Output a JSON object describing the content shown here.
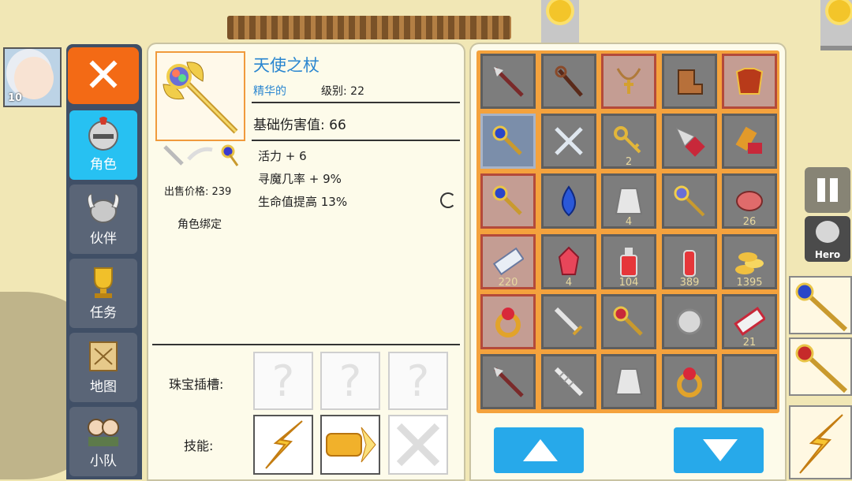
{
  "colors": {
    "accent": "#27c1f2",
    "close": "#f36a15",
    "item_name": "#2a86d0",
    "grid_frame": "#f4a23d"
  },
  "player": {
    "level": "10"
  },
  "menu": {
    "close_icon": "close-icon",
    "items": [
      {
        "label": "角色",
        "icon": "helmet-icon",
        "active": true
      },
      {
        "label": "伙伴",
        "icon": "viking-helmet-icon",
        "active": false
      },
      {
        "label": "任务",
        "icon": "trophy-icon",
        "active": false
      },
      {
        "label": "地图",
        "icon": "map-icon",
        "active": false
      },
      {
        "label": "小队",
        "icon": "party-icon",
        "active": false
      }
    ]
  },
  "item": {
    "name": "天使之杖",
    "quality": "精华的",
    "level": "级别: 22",
    "base_damage": "基础伤害值: 66",
    "stats": [
      "活力 + 6",
      "寻魔几率 + 9%",
      "生命值提高 13%"
    ],
    "sell_price": "出售价格: 239",
    "binding": "角色绑定",
    "gem_label": "珠宝插槽:",
    "gem_slots": [
      "?",
      "?",
      "?"
    ],
    "skill_label": "技能:",
    "skills": [
      {
        "icon": "lightning-icon"
      },
      {
        "icon": "dash-icon"
      },
      {
        "icon": "locked-swords-icon"
      }
    ]
  },
  "inventory": {
    "cells": [
      {
        "icon": "spear-icon",
        "count": ""
      },
      {
        "icon": "staff-icon",
        "count": ""
      },
      {
        "icon": "amulet-icon",
        "count": ""
      },
      {
        "icon": "boots-icon",
        "count": ""
      },
      {
        "icon": "armor-icon",
        "count": ""
      },
      {
        "icon": "scepter-icon",
        "count": ""
      },
      {
        "icon": "crossed-swords-icon",
        "count": ""
      },
      {
        "icon": "key-icon",
        "count": "2"
      },
      {
        "icon": "drill-icon",
        "count": ""
      },
      {
        "icon": "gauntlet-icon",
        "count": ""
      },
      {
        "icon": "scepter-icon",
        "count": ""
      },
      {
        "icon": "blue-gem-icon",
        "count": ""
      },
      {
        "icon": "stone-icon",
        "count": "4"
      },
      {
        "icon": "angel-staff-icon",
        "count": ""
      },
      {
        "icon": "meat-icon",
        "count": "26"
      },
      {
        "icon": "scroll-icon",
        "count": "220"
      },
      {
        "icon": "red-crystal-icon",
        "count": "4"
      },
      {
        "icon": "red-potion-icon",
        "count": "104"
      },
      {
        "icon": "red-vial-icon",
        "count": "389"
      },
      {
        "icon": "coins-icon",
        "count": "1395"
      },
      {
        "icon": "ring-icon",
        "count": ""
      },
      {
        "icon": "sword-icon",
        "count": ""
      },
      {
        "icon": "ruby-scepter-icon",
        "count": ""
      },
      {
        "icon": "silver-ore-icon",
        "count": ""
      },
      {
        "icon": "red-scroll-icon",
        "count": "21"
      },
      {
        "icon": "spear-icon",
        "count": ""
      },
      {
        "icon": "bone-blade-icon",
        "count": ""
      },
      {
        "icon": "stone-icon",
        "count": ""
      },
      {
        "icon": "ring-icon",
        "count": ""
      },
      {
        "icon": "",
        "count": ""
      }
    ],
    "up_icon": "up-arrow-icon",
    "down_icon": "down-arrow-icon"
  },
  "hud": {
    "hero_label": "Hero",
    "pause_icon": "pause-icon"
  }
}
